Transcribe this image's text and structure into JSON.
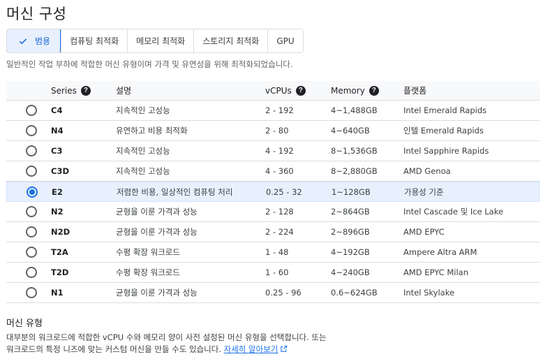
{
  "page": {
    "title": "머신 구성",
    "subtitle": "일반적인 작업 부하에 적합한 머신 유형이며 가격 및 유연성을 위해 최적화되었습니다."
  },
  "tabs": [
    {
      "label": "범용",
      "active": true
    },
    {
      "label": "컴퓨팅 최적화",
      "active": false
    },
    {
      "label": "메모리 최적화",
      "active": false
    },
    {
      "label": "스토리지 최적화",
      "active": false
    },
    {
      "label": "GPU",
      "active": false
    }
  ],
  "table": {
    "headers": {
      "series": "Series",
      "description": "설명",
      "vcpus": "vCPUs",
      "memory": "Memory",
      "platform": "플랫폼"
    },
    "rows": [
      {
        "series": "C4",
        "description": "지속적인 고성능",
        "vcpus": "2 - 192",
        "memory": "4~1,488GB",
        "platform": "Intel Emerald Rapids",
        "selected": false
      },
      {
        "series": "N4",
        "description": "유연하고 비용 최적화",
        "vcpus": "2 - 80",
        "memory": "4~640GB",
        "platform": "인텔 Emerald Rapids",
        "selected": false
      },
      {
        "series": "C3",
        "description": "지속적인 고성능",
        "vcpus": "4 - 192",
        "memory": "8~1,536GB",
        "platform": "Intel Sapphire Rapids",
        "selected": false
      },
      {
        "series": "C3D",
        "description": "지속적인 고성능",
        "vcpus": "4 - 360",
        "memory": "8~2,880GB",
        "platform": "AMD Genoa",
        "selected": false
      },
      {
        "series": "E2",
        "description": "저렴한 비용, 일상적인 컴퓨팅 처리",
        "vcpus": "0.25 - 32",
        "memory": "1~128GB",
        "platform": "가용성 기준",
        "selected": true
      },
      {
        "series": "N2",
        "description": "균형을 이룬 가격과 성능",
        "vcpus": "2 - 128",
        "memory": "2~864GB",
        "platform": "Intel Cascade 및 Ice Lake",
        "selected": false
      },
      {
        "series": "N2D",
        "description": "균형을 이룬 가격과 성능",
        "vcpus": "2 - 224",
        "memory": "2~896GB",
        "platform": "AMD EPYC",
        "selected": false
      },
      {
        "series": "T2A",
        "description": "수평 확장 워크로드",
        "vcpus": "1 - 48",
        "memory": "4~192GB",
        "platform": "Ampere Altra ARM",
        "selected": false
      },
      {
        "series": "T2D",
        "description": "수평 확장 워크로드",
        "vcpus": "1 - 60",
        "memory": "4~240GB",
        "platform": "AMD EPYC Milan",
        "selected": false
      },
      {
        "series": "N1",
        "description": "균형을 이룬 가격과 성능",
        "vcpus": "0.25 - 96",
        "memory": "0.6~624GB",
        "platform": "Intel Skylake",
        "selected": false
      }
    ]
  },
  "machine_type": {
    "title": "머신 유형",
    "desc_line1": "대부분의 워크로드에 적합한 vCPU 수와 메모리 양이 사전 설정된 머신 유형을 선택합니다. 또는",
    "desc_line2": "워크로드의 특정 니즈에 맞는 커스텀 머신을 만들 수도 있습니다.",
    "link": "자세히 알아보기"
  },
  "colors": {
    "accent": "#1a73e8",
    "selected_bg": "#e8f0fe"
  }
}
